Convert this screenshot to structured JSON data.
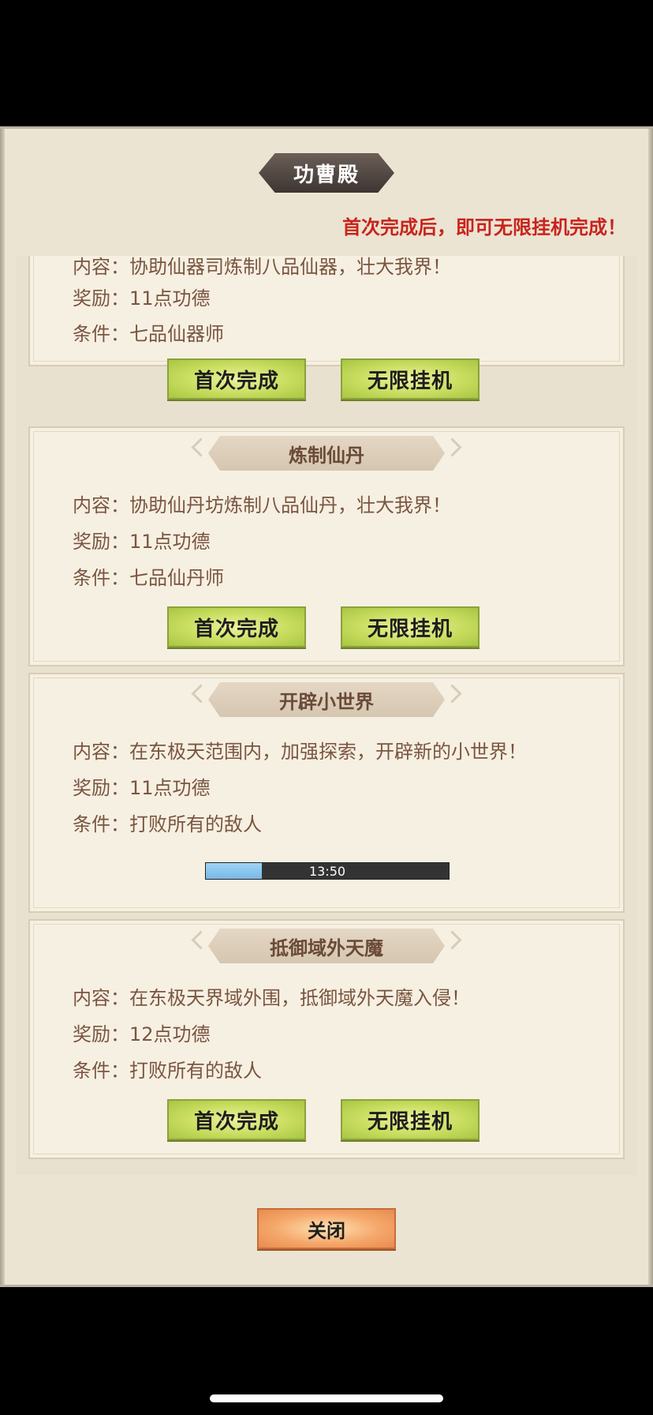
{
  "dialog": {
    "title": "功曹殿",
    "notice": "首次完成后，即可无限挂机完成！",
    "close_label": "关闭"
  },
  "labels": {
    "content": "内容：",
    "reward": "奖励：",
    "condition": "条件：",
    "first_complete": "首次完成",
    "idle": "无限挂机"
  },
  "tasks": [
    {
      "title": "",
      "content": "协助仙器司炼制八品仙器，壮大我界！",
      "reward": "11点功德",
      "condition": "七品仙器师"
    },
    {
      "title": "炼制仙丹",
      "content": "协助仙丹坊炼制八品仙丹，壮大我界！",
      "reward": "11点功德",
      "condition": "七品仙丹师"
    },
    {
      "title": "开辟小世界",
      "content": "在东极天范围内，加强探索，开辟新的小世界！",
      "reward": "11点功德",
      "condition": "打败所有的敌人",
      "progress": {
        "text": "13:50",
        "fraction": 0.23
      }
    },
    {
      "title": "抵御域外天魔",
      "content": "在东极天界域外围，抵御域外天魔入侵！",
      "reward": "12点功德",
      "condition": "打败所有的敌人"
    }
  ]
}
